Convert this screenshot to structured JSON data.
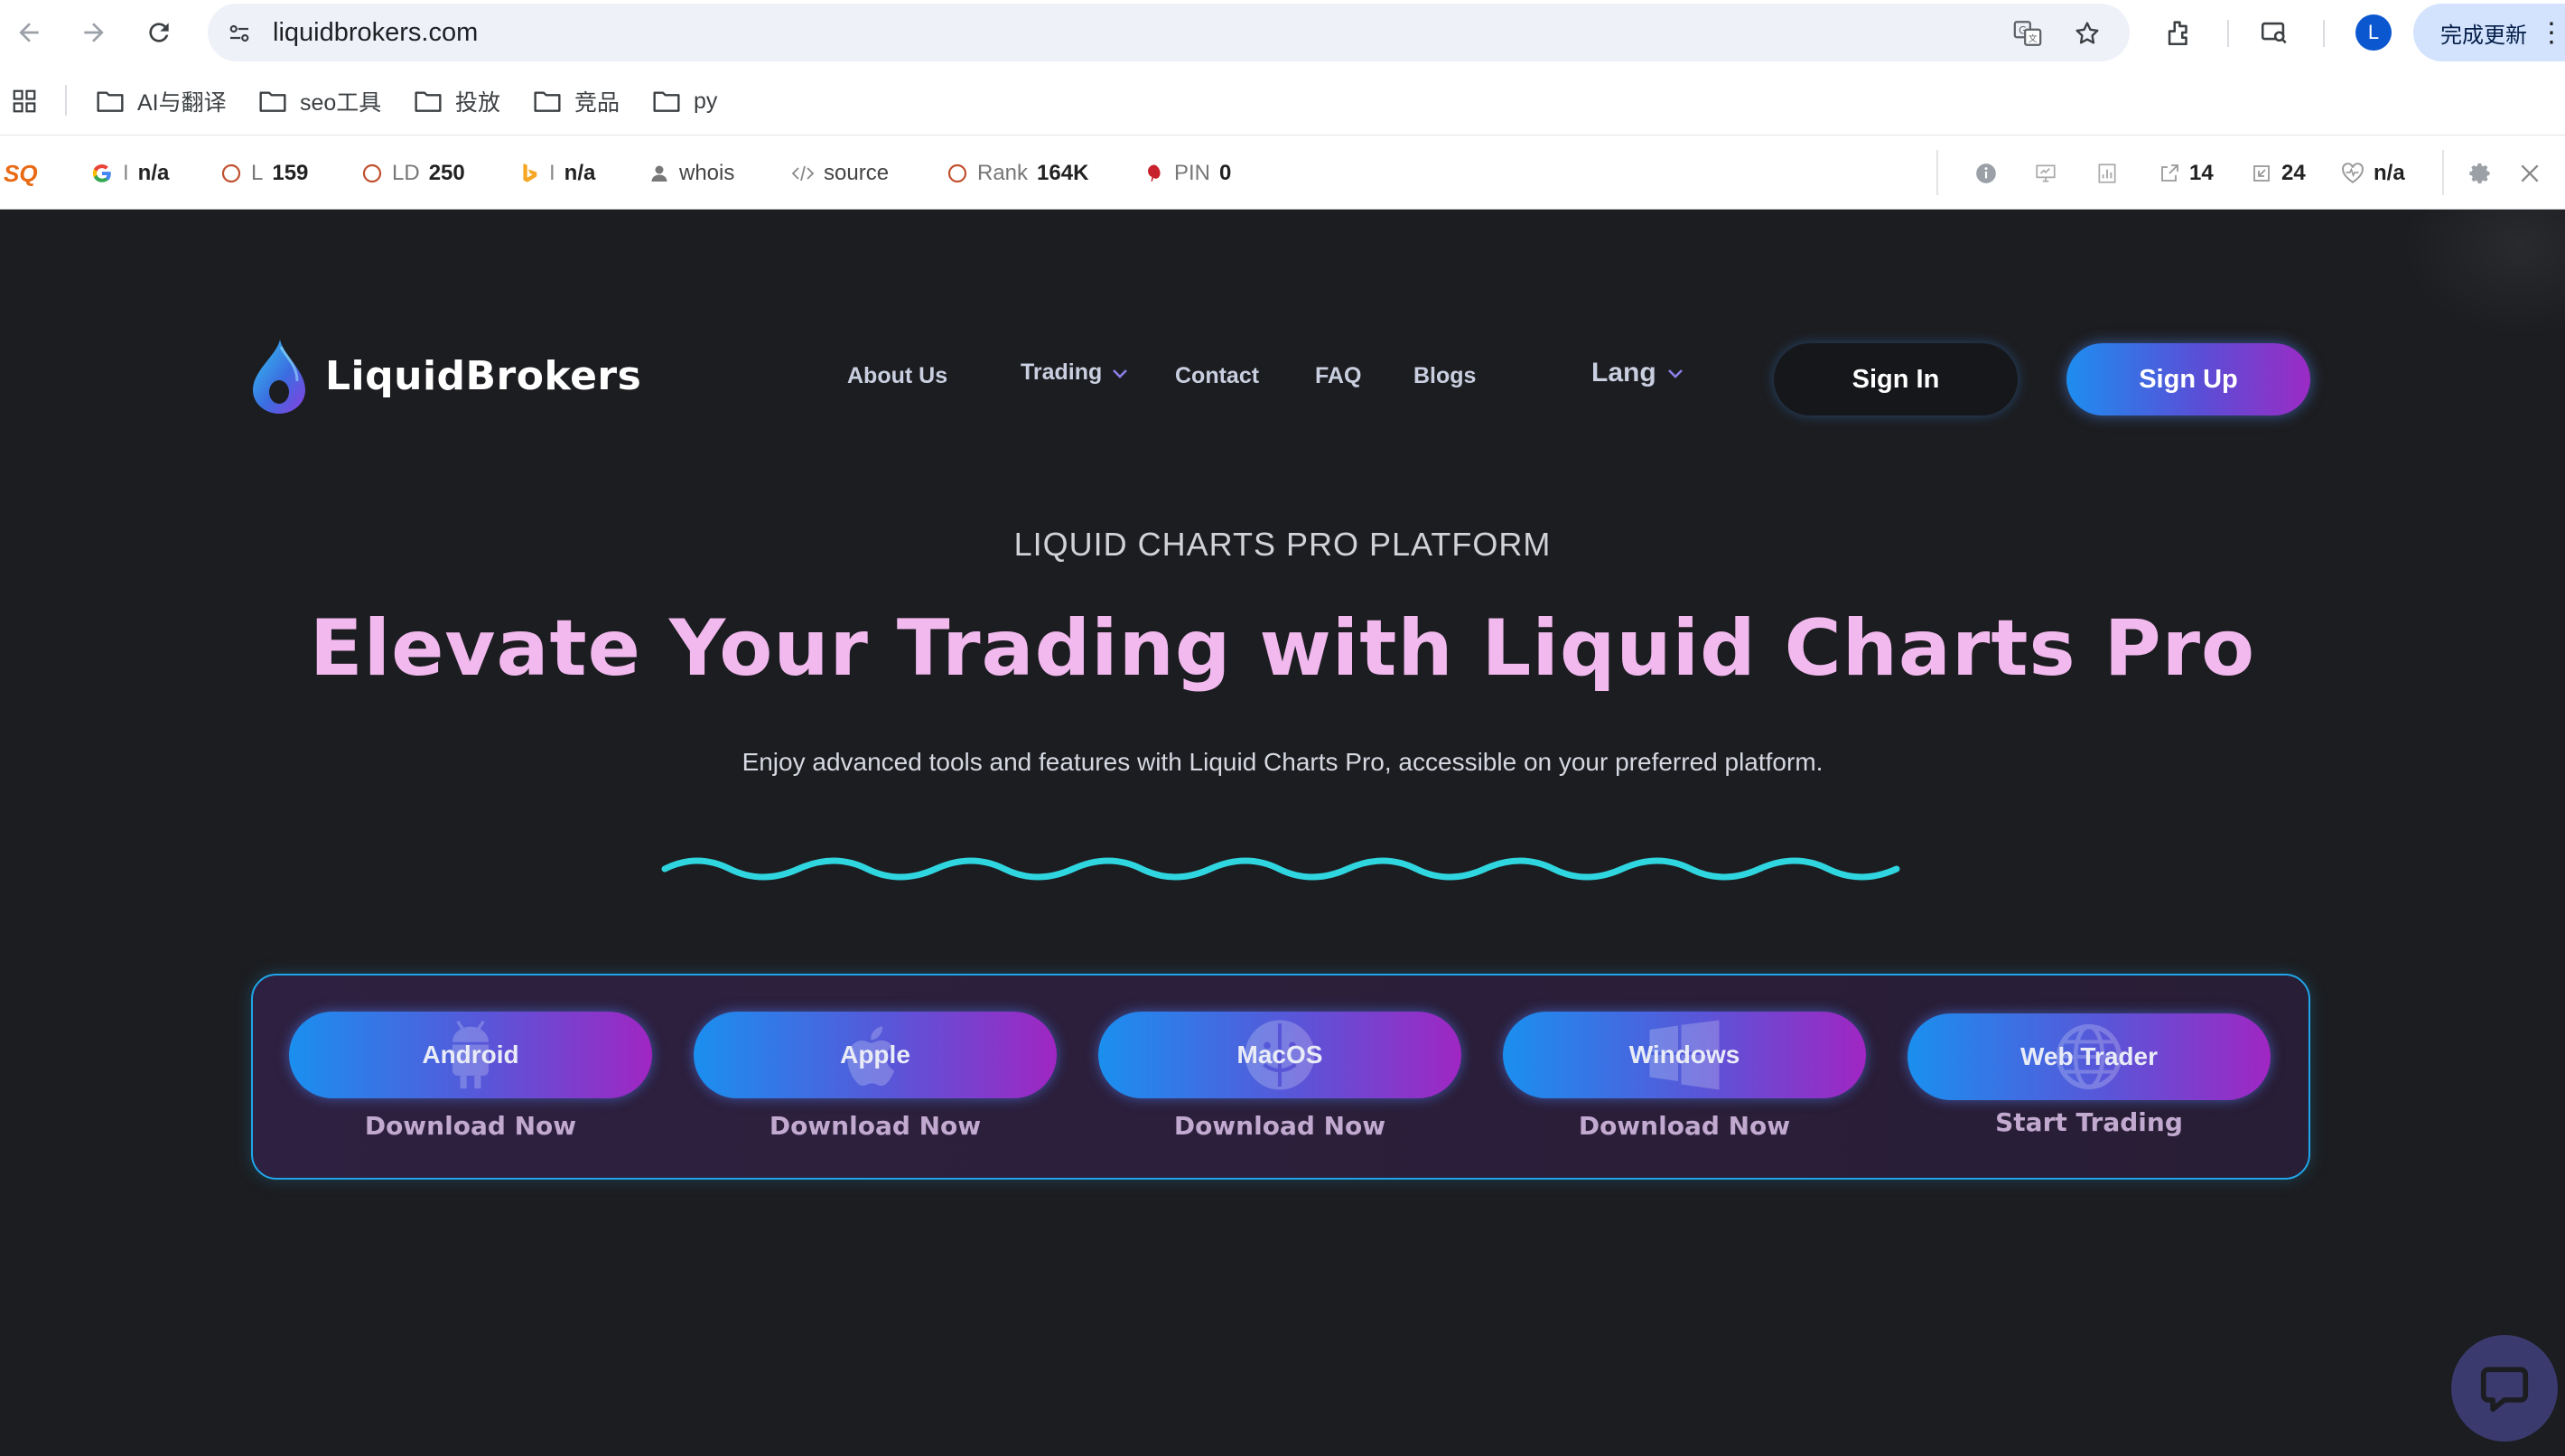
{
  "browser": {
    "url": "liquidbrokers.com",
    "profile_initial": "L",
    "update_label": "完成更新",
    "bookmarks": [
      {
        "label": "AI与翻译"
      },
      {
        "label": "seo工具"
      },
      {
        "label": "投放"
      },
      {
        "label": "竞品"
      },
      {
        "label": "py"
      }
    ]
  },
  "seo_toolbar": {
    "logo": "SQ",
    "google_prefix": "I",
    "google_value": "n/a",
    "l_prefix": "L",
    "l_value": "159",
    "ld_prefix": "LD",
    "ld_value": "250",
    "bing_prefix": "I",
    "bing_value": "n/a",
    "whois": "whois",
    "source": "source",
    "rank_prefix": "Rank",
    "rank_value": "164K",
    "pin_prefix": "PIN",
    "pin_value": "0",
    "ext_links": "14",
    "int_links": "24",
    "health": "n/a"
  },
  "site": {
    "brand": "LiquidBrokers",
    "nav": {
      "about": "About Us",
      "trading": "Trading",
      "contact": "Contact",
      "faq": "FAQ",
      "blogs": "Blogs",
      "lang": "Lang"
    },
    "sign_in": "Sign In",
    "sign_up": "Sign Up",
    "eyebrow": "LIQUID CHARTS PRO PLATFORM",
    "headline": "Elevate Your Trading with Liquid Charts Pro",
    "subtext": "Enjoy advanced tools and features with Liquid Charts Pro, accessible on your preferred platform.",
    "platforms": [
      {
        "label": "Android",
        "action": "Download Now"
      },
      {
        "label": "Apple",
        "action": "Download Now"
      },
      {
        "label": "MacOS",
        "action": "Download Now"
      },
      {
        "label": "Windows",
        "action": "Download Now"
      },
      {
        "label": "Web Trader",
        "action": "Start Trading"
      }
    ],
    "colors": {
      "background": "#1c1d20",
      "headline": "#f1b9ee",
      "wave": "#2fd6e0",
      "gradient_start": "#1a8fef",
      "gradient_end": "#a026c2",
      "panel_border": "#1fa6e8"
    }
  }
}
